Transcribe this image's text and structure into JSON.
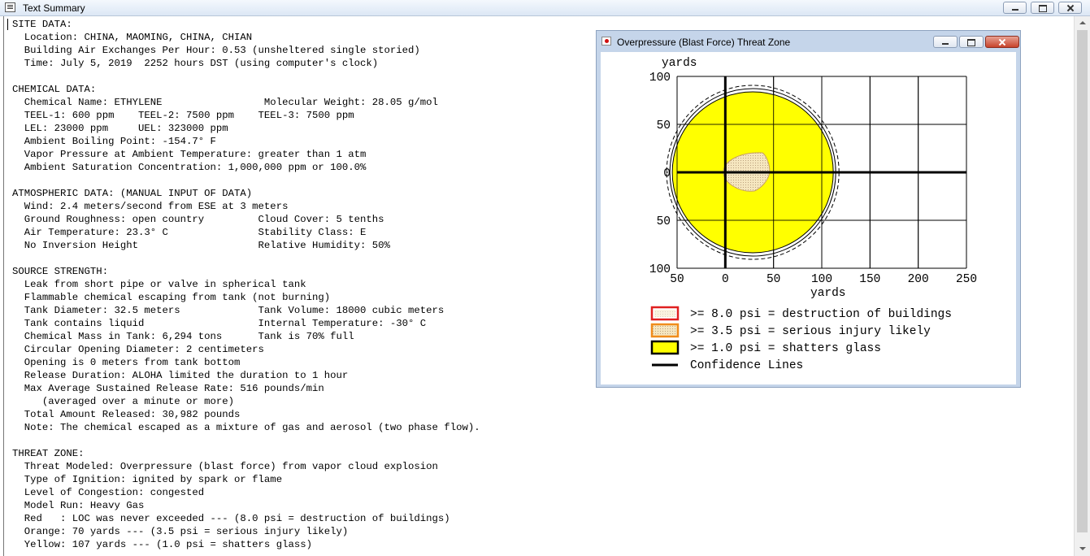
{
  "window": {
    "title": "Text Summary"
  },
  "summary_lines": [
    "SITE DATA:",
    "  Location: CHINA, MAOMING, CHINA, CHIAN",
    "  Building Air Exchanges Per Hour: 0.53 (unsheltered single storied)",
    "  Time: July 5, 2019  2252 hours DST (using computer's clock)",
    "",
    "CHEMICAL DATA:",
    "  Chemical Name: ETHYLENE                 Molecular Weight: 28.05 g/mol",
    "  TEEL-1: 600 ppm    TEEL-2: 7500 ppm    TEEL-3: 7500 ppm",
    "  LEL: 23000 ppm     UEL: 323000 ppm",
    "  Ambient Boiling Point: -154.7° F",
    "  Vapor Pressure at Ambient Temperature: greater than 1 atm",
    "  Ambient Saturation Concentration: 1,000,000 ppm or 100.0%",
    "",
    "ATMOSPHERIC DATA: (MANUAL INPUT OF DATA)",
    "  Wind: 2.4 meters/second from ESE at 3 meters",
    "  Ground Roughness: open country         Cloud Cover: 5 tenths",
    "  Air Temperature: 23.3° C               Stability Class: E",
    "  No Inversion Height                    Relative Humidity: 50%",
    "",
    "SOURCE STRENGTH:",
    "  Leak from short pipe or valve in spherical tank",
    "  Flammable chemical escaping from tank (not burning)",
    "  Tank Diameter: 32.5 meters             Tank Volume: 18000 cubic meters",
    "  Tank contains liquid                   Internal Temperature: -30° C",
    "  Chemical Mass in Tank: 6,294 tons      Tank is 70% full",
    "  Circular Opening Diameter: 2 centimeters",
    "  Opening is 0 meters from tank bottom",
    "  Release Duration: ALOHA limited the duration to 1 hour",
    "  Max Average Sustained Release Rate: 516 pounds/min",
    "     (averaged over a minute or more)",
    "  Total Amount Released: 30,982 pounds",
    "  Note: The chemical escaped as a mixture of gas and aerosol (two phase flow).",
    "",
    "THREAT ZONE:",
    "  Threat Modeled: Overpressure (blast force) from vapor cloud explosion",
    "  Type of Ignition: ignited by spark or flame",
    "  Level of Congestion: congested",
    "  Model Run: Heavy Gas",
    "  Red   : LOC was never exceeded --- (8.0 psi = destruction of buildings)",
    "  Orange: 70 yards --- (3.5 psi = serious injury likely)",
    "  Yellow: 107 yards --- (1.0 psi = shatters glass)"
  ],
  "threat_window": {
    "title": "Overpressure (Blast Force) Threat Zone",
    "y_unit": "yards",
    "x_unit": "yards",
    "x_ticks": [
      "50",
      "0",
      "50",
      "100",
      "150",
      "200",
      "250"
    ],
    "y_ticks": [
      "100",
      "50",
      "0",
      "50",
      "100"
    ],
    "legend": [
      {
        "label": ">= 8.0 psi = destruction of buildings",
        "fill": "#ffffff",
        "border": "#e02020"
      },
      {
        "label": ">= 3.5 psi = serious injury likely",
        "fill": "#f5e6bf",
        "border": "#f08c1c"
      },
      {
        "label": ">= 1.0 psi = shatters glass",
        "fill": "#ffff00",
        "border": "#000000"
      },
      {
        "label": "Confidence Lines",
        "fill": "",
        "border": "#000000"
      }
    ],
    "zones": {
      "yellow_radius_yards": 107,
      "orange_radius_yards": 70
    }
  },
  "colors": {
    "yellow_zone": "#ffff00",
    "orange_zone": "#f5e6bf",
    "red_zone": "#e02020",
    "titlebar": "#dce7f5"
  },
  "icons": {
    "app": "text-summary-icon",
    "threat": "threat-zone-icon"
  }
}
